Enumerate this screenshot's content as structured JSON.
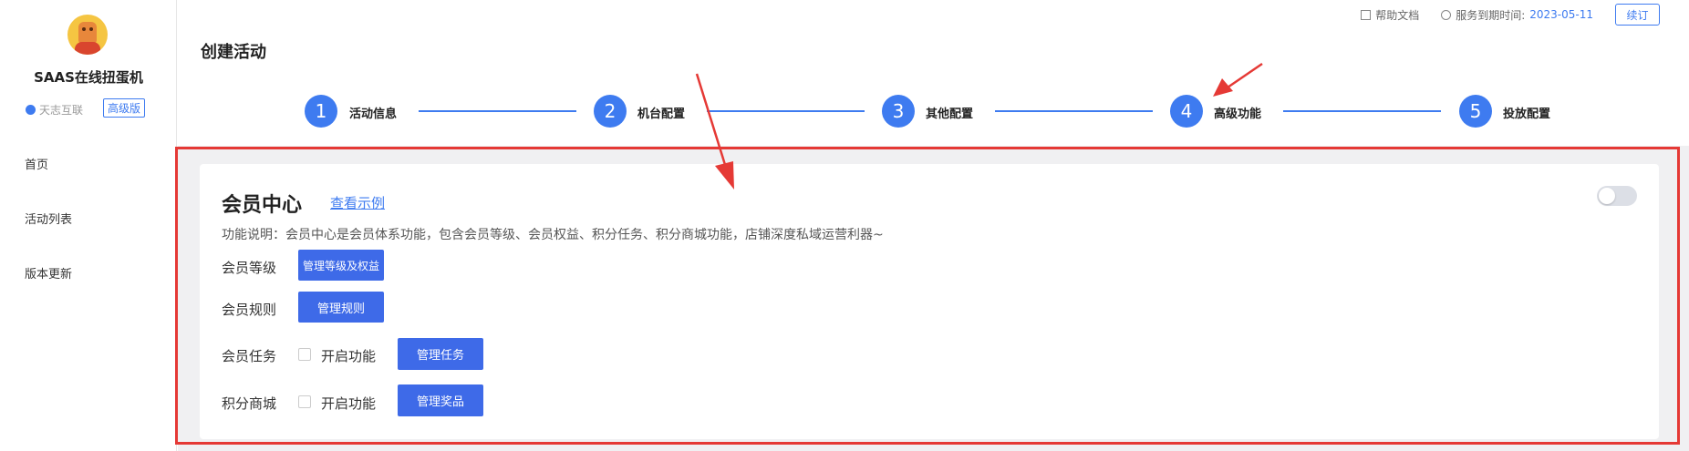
{
  "sidebar": {
    "brand": "SAAS在线扭蛋机",
    "company": "天志互联",
    "version_badge": "高级版",
    "nav": [
      "首页",
      "活动列表",
      "版本更新"
    ]
  },
  "topbar": {
    "help_doc": "帮助文档",
    "expiry_label": "服务到期时间:",
    "expiry_date": "2023-05-11",
    "renew": "续订"
  },
  "page_title": "创建活动",
  "steps": [
    {
      "num": "1",
      "label": "活动信息"
    },
    {
      "num": "2",
      "label": "机台配置"
    },
    {
      "num": "3",
      "label": "其他配置"
    },
    {
      "num": "4",
      "label": "高级功能"
    },
    {
      "num": "5",
      "label": "投放配置"
    }
  ],
  "member_center": {
    "title": "会员中心",
    "example_link": "查看示例",
    "enabled": false,
    "description": "功能说明：会员中心是会员体系功能，包含会员等级、会员权益、积分任务、积分商城功能，店铺深度私域运营利器~",
    "rows": {
      "level": {
        "label": "会员等级",
        "button": "管理等级及权益"
      },
      "rules": {
        "label": "会员规则",
        "button": "管理规则"
      },
      "tasks": {
        "label": "会员任务",
        "checkbox": "开启功能",
        "button": "管理任务"
      },
      "mall": {
        "label": "积分商城",
        "checkbox": "开启功能",
        "button": "管理奖品"
      }
    }
  },
  "colors": {
    "accent": "#3e7bf0",
    "annotation": "#e53935"
  }
}
